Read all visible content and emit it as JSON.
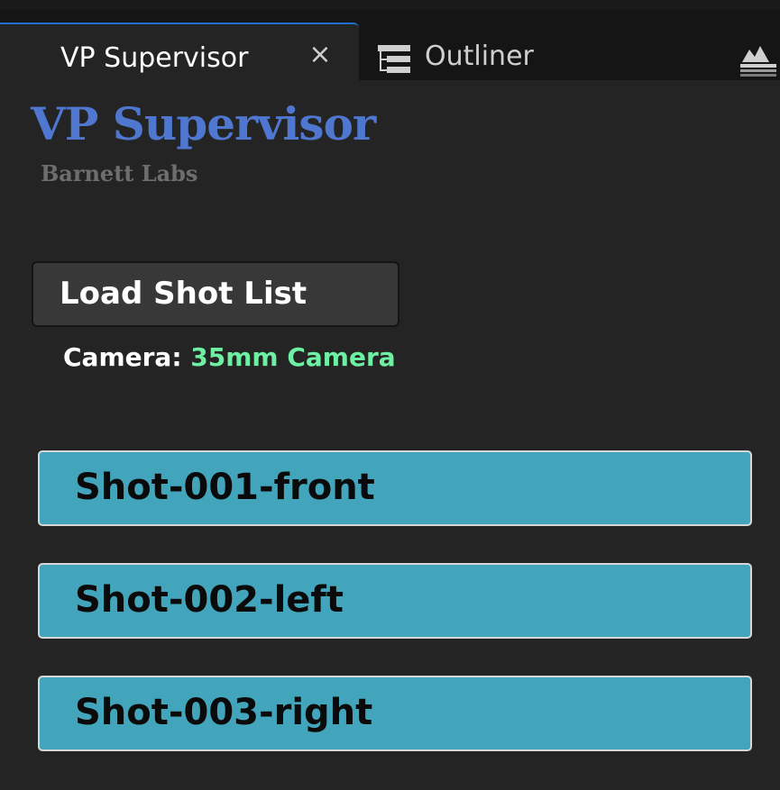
{
  "tabs": [
    {
      "label": "VP Supervisor",
      "active": true,
      "close_symbol": "×"
    },
    {
      "label": "Outliner",
      "active": false,
      "icon": "outliner-icon"
    }
  ],
  "toolbar": {
    "layers_icon": "layers-icon"
  },
  "plugin": {
    "title": "VP Supervisor",
    "subtitle": "Barnett Labs",
    "load_button_label": "Load Shot List",
    "camera_label": "Camera:",
    "camera_value": "35mm Camera",
    "shots": [
      {
        "label": "Shot-001-front"
      },
      {
        "label": "Shot-002-left"
      },
      {
        "label": "Shot-003-right"
      }
    ]
  },
  "colors": {
    "accent_tab": "#1e6fd0",
    "logo": "#4f77cf",
    "camera_value": "#6ef0a2",
    "shot_button": "#42a5bb"
  }
}
